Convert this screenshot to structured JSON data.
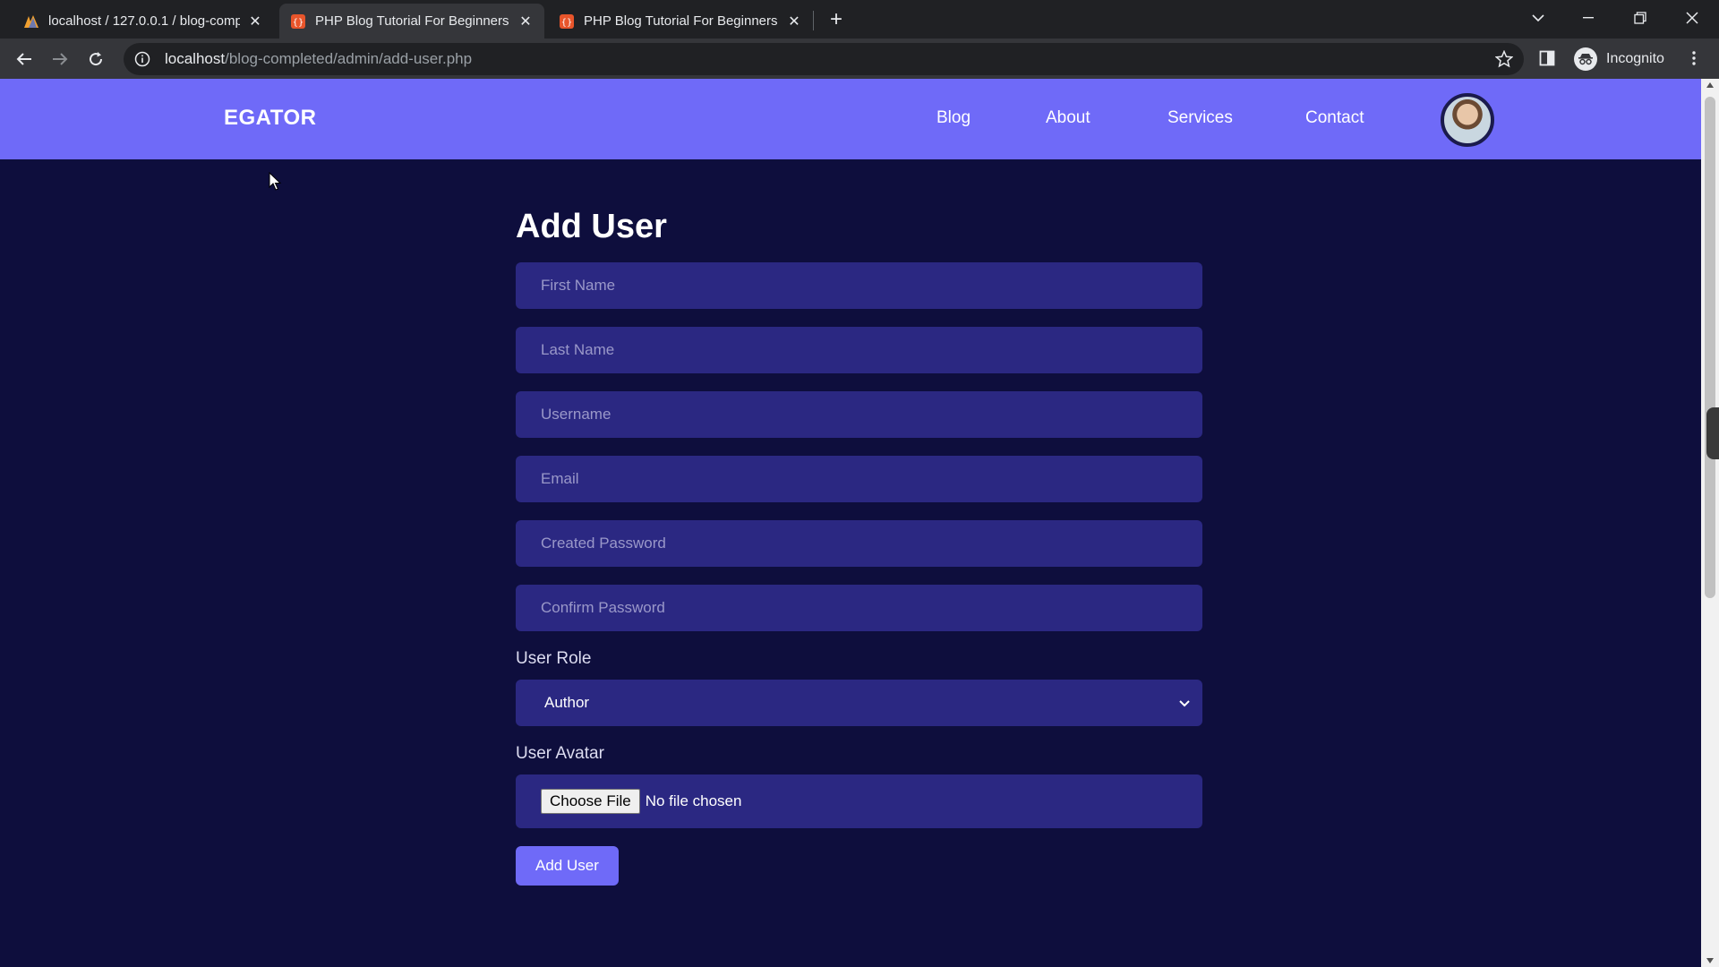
{
  "browser": {
    "tabs": [
      {
        "title": "localhost / 127.0.0.1 / blog-comp",
        "favicon": "phpmyadmin-icon",
        "active": false
      },
      {
        "title": "PHP Blog Tutorial For Beginners",
        "favicon": "html-icon",
        "active": true
      },
      {
        "title": "PHP Blog Tutorial For Beginners",
        "favicon": "html-icon",
        "active": false
      }
    ],
    "url_host": "localhost",
    "url_path": "/blog-completed/admin/add-user.php",
    "incognito_label": "Incognito"
  },
  "site": {
    "brand": "EGATOR",
    "nav": [
      "Blog",
      "About",
      "Services",
      "Contact"
    ],
    "accent_color": "#6f6af8",
    "background_color": "#0e0e3d"
  },
  "form": {
    "title": "Add User",
    "placeholders": {
      "first_name": "First Name",
      "last_name": "Last Name",
      "username": "Username",
      "email": "Email",
      "created_password": "Created Password",
      "confirm_password": "Confirm Password"
    },
    "role_label": "User Role",
    "role_value": "Author",
    "avatar_label": "User Avatar",
    "file_button": "Choose File",
    "file_status": "No file chosen",
    "submit_label": "Add User"
  }
}
